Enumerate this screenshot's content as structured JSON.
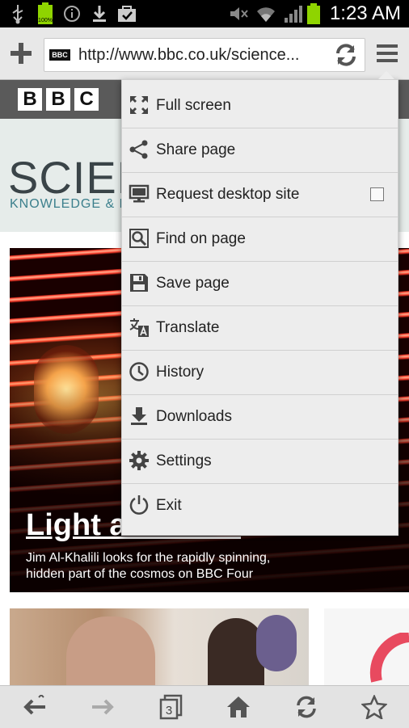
{
  "status_bar": {
    "time": "1:23 AM",
    "battery_label": "100%",
    "icons": [
      "usb-icon",
      "battery-icon",
      "info-icon",
      "download-icon",
      "bag-icon",
      "mute-icon",
      "wifi-icon",
      "signal-icon",
      "battery-icon"
    ]
  },
  "toolbar": {
    "url": "http://www.bbc.co.uk/science...",
    "site_badge": "BBC",
    "icons": [
      "add-tab-icon",
      "reload-icon",
      "menu-icon"
    ]
  },
  "page": {
    "logo_letters": [
      "B",
      "B",
      "C"
    ],
    "section_title": "SCIEN",
    "section_subtitle": "KNOWLEDGE & L",
    "hero_title": "Light and Dark",
    "hero_desc": "Jim Al-Khalili looks for the rapidly spinning, hidden part of the cosmos on BBC Four"
  },
  "menu": {
    "items": [
      {
        "label": "Full screen",
        "icon": "fullscreen-icon"
      },
      {
        "label": "Share page",
        "icon": "share-icon"
      },
      {
        "label": "Request desktop site",
        "icon": "monitor-icon",
        "checked": false
      },
      {
        "label": "Find on page",
        "icon": "find-icon"
      },
      {
        "label": "Save page",
        "icon": "save-icon"
      },
      {
        "label": "Translate",
        "icon": "translate-icon"
      },
      {
        "label": "History",
        "icon": "clock-icon"
      },
      {
        "label": "Downloads",
        "icon": "download-icon"
      },
      {
        "label": "Settings",
        "icon": "gear-icon"
      },
      {
        "label": "Exit",
        "icon": "power-icon"
      }
    ]
  },
  "bottom_bar": {
    "tab_count": "3",
    "icons": [
      "back-icon",
      "forward-icon",
      "tabs-icon",
      "home-icon",
      "refresh-icon",
      "bookmark-star-icon"
    ]
  },
  "colors": {
    "status_bar": "#000000",
    "toolbar": "#e8e8e8",
    "menu_bg": "#ededed",
    "battery_green": "#8fd400",
    "bbc_bar": "#5a5a5a"
  }
}
